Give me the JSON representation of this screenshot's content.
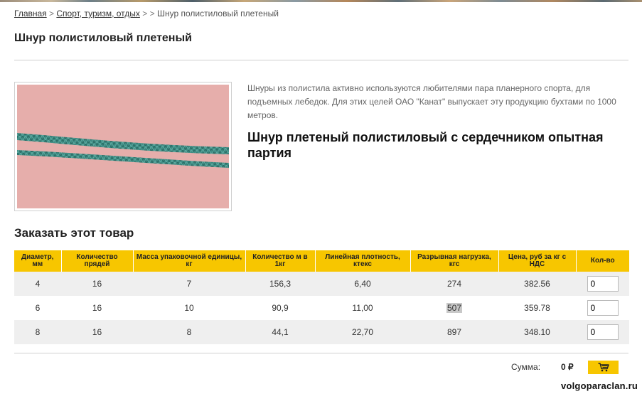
{
  "breadcrumb": {
    "home": "Главная",
    "sep1": ">",
    "category": "Спорт, туризм, отдых",
    "sep2": ">",
    "sep3": ">",
    "current": "Шнур полистиловый плетеный"
  },
  "page_title": "Шнур полистиловый плетеный",
  "description": "Шнуры из полистила активно используются любителями пара планерного спорта, для подъемных лебедок. Для этих целей ОАО \"Канат\" выпускает эту продукцию бухтами по 1000 метров.",
  "subtitle": "Шнур плетеный полистиловый с сердечником опытная партия",
  "order_title": "Заказать этот товар",
  "table": {
    "headers": [
      "Диаметр, мм",
      "Количество прядей",
      "Масса упаковочной единицы, кг",
      "Количество м в 1кг",
      "Линейная плотность, ктекс",
      "Разрывная нагрузка, кгс",
      "Цена, руб за кг с НДС",
      "Кол-во"
    ],
    "rows": [
      {
        "diameter": "4",
        "strands": "16",
        "mass": "7",
        "meters": "156,3",
        "density": "6,40",
        "load": "274",
        "price": "382.56",
        "qty": "0"
      },
      {
        "diameter": "6",
        "strands": "16",
        "mass": "10",
        "meters": "90,9",
        "density": "11,00",
        "load": "507",
        "price": "359.78",
        "qty": "0"
      },
      {
        "diameter": "8",
        "strands": "16",
        "mass": "8",
        "meters": "44,1",
        "density": "22,70",
        "load": "897",
        "price": "348.10",
        "qty": "0"
      }
    ]
  },
  "summary": {
    "label": "Сумма:",
    "value": "0 ₽"
  },
  "icons": {
    "cart": "cart-icon"
  },
  "colors": {
    "accent": "#f7c600",
    "row_alt": "#efefef",
    "photo_bg": "#e6aeab",
    "cord": "#3f8f86"
  },
  "watermark": "volgoparaclan.ru"
}
